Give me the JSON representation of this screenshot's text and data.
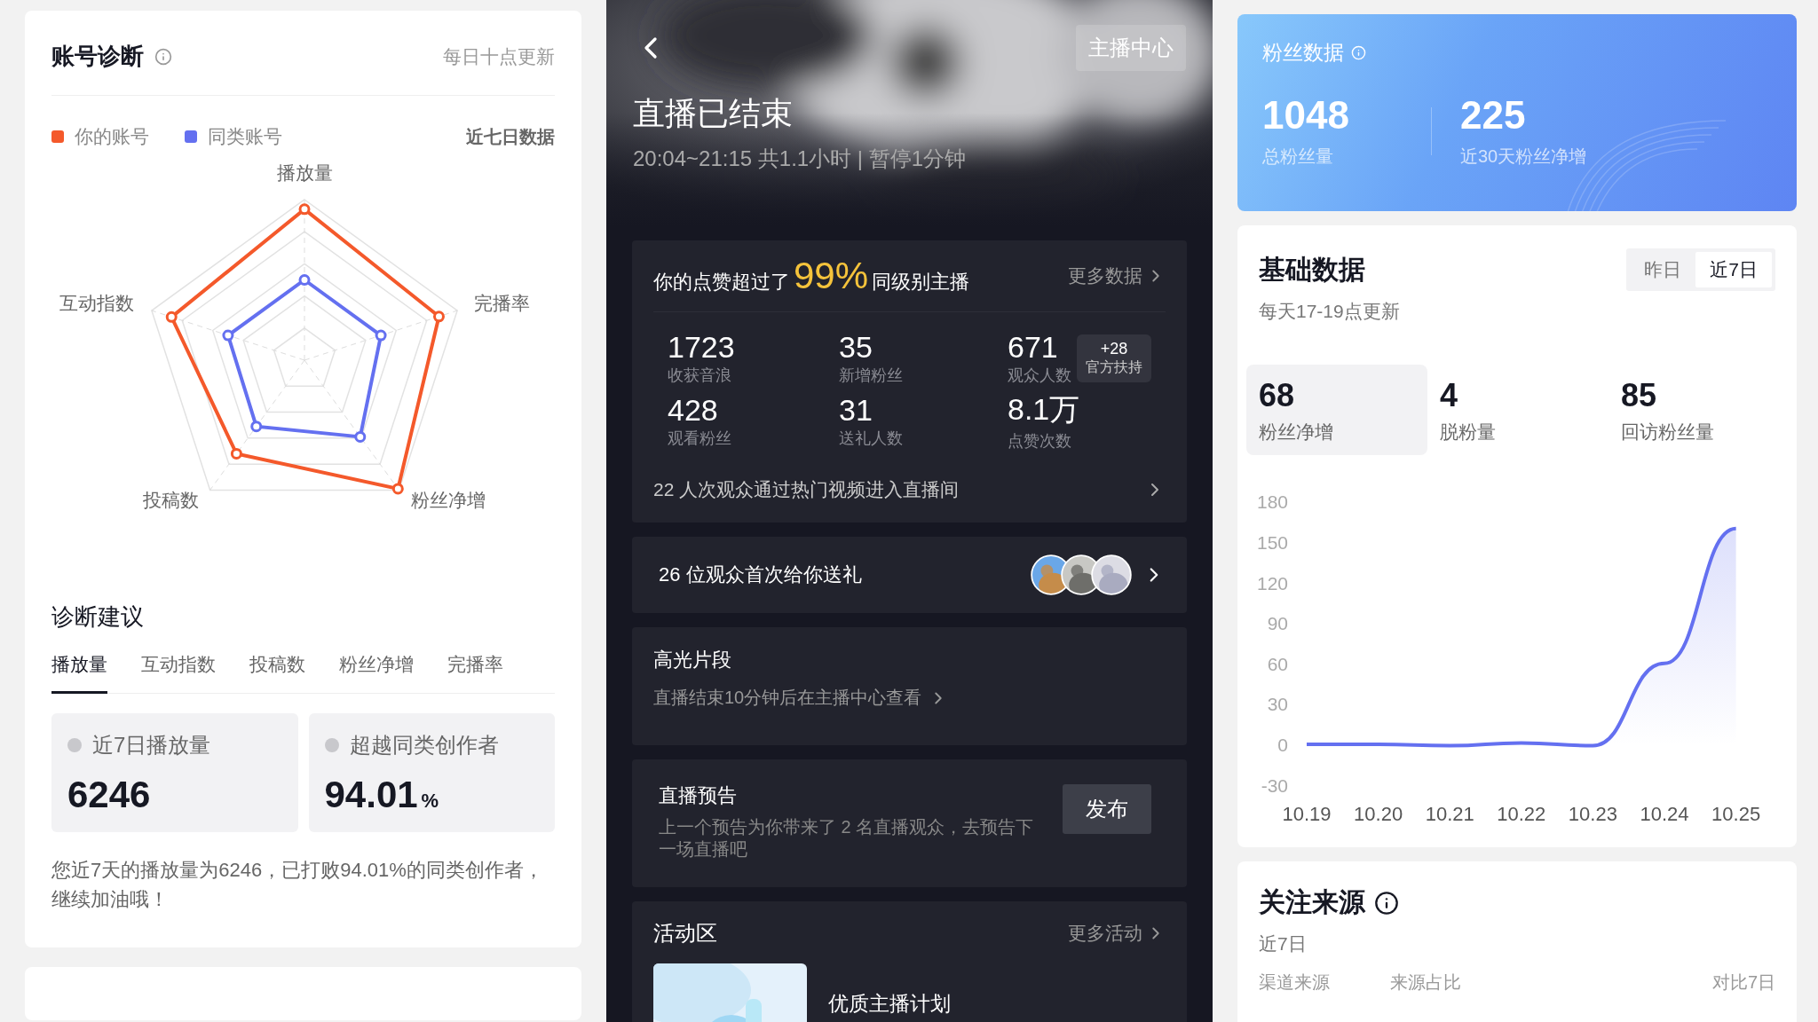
{
  "diagnosis": {
    "title": "账号诊断",
    "note": "每日十点更新",
    "legend": [
      {
        "label": "你的账号",
        "color": "#f4592b"
      },
      {
        "label": "同类账号",
        "color": "#6470f0"
      }
    ],
    "range": "近七日数据",
    "axes": [
      "播放量",
      "完播率",
      "粉丝净增",
      "投稿数",
      "互动指数"
    ]
  },
  "advice": {
    "title": "诊断建议",
    "tabs": [
      {
        "label": "播放量",
        "selected": true
      },
      {
        "label": "互动指数",
        "selected": false
      },
      {
        "label": "投稿数",
        "selected": false
      },
      {
        "label": "粉丝净增",
        "selected": false
      },
      {
        "label": "完播率",
        "selected": false
      }
    ],
    "stats": [
      {
        "label": "近7日播放量",
        "value": "6246"
      },
      {
        "label": "超越同类创作者",
        "value": "94.01",
        "unit": "%"
      }
    ],
    "summary": "您近7天的播放量为6246，已打败94.01%的同类创作者，继续加油哦！"
  },
  "live": {
    "center_button": "主播中心",
    "title": "直播已结束",
    "subtitle": "20:04~21:15 共1.1小时 | 暂停1分钟",
    "likes": {
      "before": "你的点赞超过了",
      "highlight": "99%",
      "after": "同级别主播",
      "link": "更多数据"
    },
    "stats": [
      {
        "value": "1723",
        "label": "收获音浪"
      },
      {
        "value": "35",
        "label": "新增粉丝"
      },
      {
        "value": "671",
        "label": "观众人数",
        "badge_value": "+28",
        "badge_label": "官方扶持"
      },
      {
        "value": "428",
        "label": "观看粉丝"
      },
      {
        "value": "31",
        "label": "送礼人数"
      },
      {
        "value": "8.1万",
        "label": "点赞次数"
      }
    ],
    "hot_video": "22 人次观众通过热门视频进入直播间",
    "gifts": "26 位观众首次给你送礼",
    "highlights": {
      "title": "高光片段",
      "text": "直播结束10分钟后在主播中心查看"
    },
    "preview": {
      "title": "直播预告",
      "text": "上一个预告为你带来了 2 名直播观众，去预告下一场直播吧",
      "button": "发布"
    },
    "activity": {
      "title": "活动区",
      "link": "更多活动",
      "item": "优质主播计划"
    }
  },
  "fans": {
    "summary": {
      "title": "粉丝数据",
      "stats": [
        {
          "value": "1048",
          "label": "总粉丝量"
        },
        {
          "value": "225",
          "label": "近30天粉丝净增"
        }
      ]
    },
    "basic": {
      "title": "基础数据",
      "note": "每天17-19点更新",
      "periods": [
        {
          "label": "昨日",
          "selected": false
        },
        {
          "label": "近7日",
          "selected": true
        }
      ],
      "metrics": [
        {
          "value": "68",
          "label": "粉丝净增",
          "selected": true
        },
        {
          "value": "4",
          "label": "脱粉量",
          "selected": false
        },
        {
          "value": "85",
          "label": "回访粉丝量",
          "selected": false
        }
      ],
      "chart_data": {
        "type": "area",
        "categories": [
          "10.19",
          "10.20",
          "10.21",
          "10.22",
          "10.23",
          "10.24",
          "10.25"
        ],
        "series": [
          {
            "color": "#6470f0",
            "values": [
              0,
              0,
              -1,
              1,
              -1,
              60,
              160
            ]
          }
        ],
        "ylim": [
          -30,
          180
        ],
        "yticks": [
          -30,
          0,
          30,
          60,
          90,
          120,
          150,
          180
        ]
      }
    },
    "source": {
      "title": "关注来源",
      "range": "近7日",
      "columns": [
        "渠道来源",
        "来源占比",
        "对比7日"
      ]
    }
  }
}
